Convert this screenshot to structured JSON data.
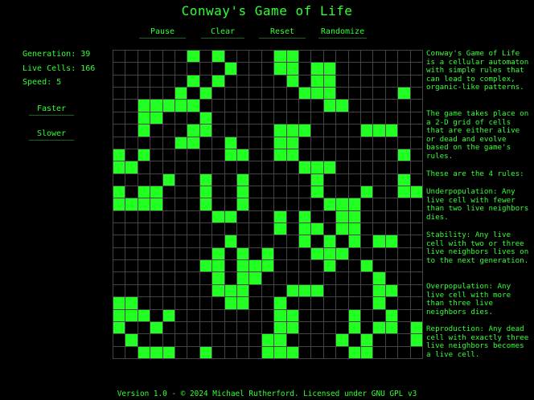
{
  "title": "Conway's Game of Life",
  "controls": {
    "pause": "Pause",
    "clear": "Clear",
    "reset": "Reset",
    "randomize": "Randomize"
  },
  "stats": {
    "generation": "Generation: 39",
    "live_cells": "Live Cells: 166",
    "speed": "Speed: 5"
  },
  "speed_controls": {
    "faster": "Faster",
    "slower": "Slower"
  },
  "info": {
    "intro": "Conway's Game of Life is a cellular automaton with simple rules that can lead to complex, organic-like patterns.",
    "grid_desc": "The game takes place on a 2-D grid of cells that are either alive or dead and evolve based on the game's rules.",
    "rules_header": "These are the 4 rules:",
    "underpopulation": "Underpopulation: Any live cell with fewer than two live neighbors dies.",
    "stability": "Stability: Any live cell with two or three live neighbors lives on to the next generation.",
    "overpopulation": "Overpopulation: Any live cell with more than three live neighbors dies.",
    "reproduction": "Reproduction: Any dead cell with exactly three live neighbors becomes a live cell."
  },
  "footer": "Version 1.0 - © 2024 Michael Rutherford. Licensed under GNU GPL v3",
  "colors": {
    "alive": "#22ff22",
    "text": "#33ff33",
    "grid_line": "#444444",
    "background": "#000000"
  },
  "board": {
    "rows": 25,
    "cols": 25,
    "alive": [
      [
        0,
        6
      ],
      [
        0,
        8
      ],
      [
        0,
        13
      ],
      [
        0,
        14
      ],
      [
        1,
        9
      ],
      [
        1,
        13
      ],
      [
        1,
        14
      ],
      [
        1,
        16
      ],
      [
        1,
        17
      ],
      [
        2,
        6
      ],
      [
        2,
        8
      ],
      [
        2,
        14
      ],
      [
        2,
        16
      ],
      [
        2,
        17
      ],
      [
        3,
        5
      ],
      [
        3,
        7
      ],
      [
        3,
        15
      ],
      [
        3,
        16
      ],
      [
        3,
        17
      ],
      [
        3,
        23
      ],
      [
        4,
        2
      ],
      [
        4,
        3
      ],
      [
        4,
        4
      ],
      [
        4,
        5
      ],
      [
        4,
        6
      ],
      [
        4,
        17
      ],
      [
        4,
        18
      ],
      [
        5,
        2
      ],
      [
        5,
        3
      ],
      [
        5,
        7
      ],
      [
        6,
        2
      ],
      [
        6,
        6
      ],
      [
        6,
        7
      ],
      [
        6,
        13
      ],
      [
        6,
        14
      ],
      [
        6,
        15
      ],
      [
        6,
        20
      ],
      [
        6,
        21
      ],
      [
        6,
        22
      ],
      [
        7,
        5
      ],
      [
        7,
        6
      ],
      [
        7,
        9
      ],
      [
        7,
        13
      ],
      [
        7,
        14
      ],
      [
        8,
        0
      ],
      [
        8,
        2
      ],
      [
        8,
        9
      ],
      [
        8,
        10
      ],
      [
        8,
        13
      ],
      [
        8,
        14
      ],
      [
        8,
        23
      ],
      [
        9,
        0
      ],
      [
        9,
        1
      ],
      [
        9,
        15
      ],
      [
        9,
        16
      ],
      [
        9,
        17
      ],
      [
        10,
        4
      ],
      [
        10,
        7
      ],
      [
        10,
        10
      ],
      [
        10,
        16
      ],
      [
        10,
        23
      ],
      [
        11,
        0
      ],
      [
        11,
        2
      ],
      [
        11,
        3
      ],
      [
        11,
        7
      ],
      [
        11,
        10
      ],
      [
        11,
        16
      ],
      [
        11,
        20
      ],
      [
        11,
        23
      ],
      [
        11,
        24
      ],
      [
        12,
        0
      ],
      [
        12,
        1
      ],
      [
        12,
        2
      ],
      [
        12,
        3
      ],
      [
        12,
        7
      ],
      [
        12,
        10
      ],
      [
        12,
        17
      ],
      [
        12,
        18
      ],
      [
        12,
        19
      ],
      [
        13,
        8
      ],
      [
        13,
        9
      ],
      [
        13,
        13
      ],
      [
        13,
        15
      ],
      [
        13,
        18
      ],
      [
        13,
        19
      ],
      [
        14,
        13
      ],
      [
        14,
        15
      ],
      [
        14,
        16
      ],
      [
        14,
        18
      ],
      [
        14,
        19
      ],
      [
        15,
        9
      ],
      [
        15,
        15
      ],
      [
        15,
        17
      ],
      [
        15,
        19
      ],
      [
        15,
        21
      ],
      [
        15,
        22
      ],
      [
        16,
        8
      ],
      [
        16,
        10
      ],
      [
        16,
        12
      ],
      [
        16,
        16
      ],
      [
        16,
        17
      ],
      [
        16,
        18
      ],
      [
        17,
        7
      ],
      [
        17,
        8
      ],
      [
        17,
        10
      ],
      [
        17,
        11
      ],
      [
        17,
        12
      ],
      [
        17,
        17
      ],
      [
        17,
        20
      ],
      [
        18,
        8
      ],
      [
        18,
        10
      ],
      [
        18,
        11
      ],
      [
        18,
        21
      ],
      [
        19,
        8
      ],
      [
        19,
        9
      ],
      [
        19,
        10
      ],
      [
        19,
        14
      ],
      [
        19,
        15
      ],
      [
        19,
        16
      ],
      [
        19,
        21
      ],
      [
        19,
        22
      ],
      [
        20,
        0
      ],
      [
        20,
        1
      ],
      [
        20,
        9
      ],
      [
        20,
        10
      ],
      [
        20,
        13
      ],
      [
        20,
        21
      ],
      [
        21,
        0
      ],
      [
        21,
        1
      ],
      [
        21,
        2
      ],
      [
        21,
        4
      ],
      [
        21,
        13
      ],
      [
        21,
        14
      ],
      [
        21,
        19
      ],
      [
        21,
        22
      ],
      [
        22,
        0
      ],
      [
        22,
        3
      ],
      [
        22,
        13
      ],
      [
        22,
        14
      ],
      [
        22,
        19
      ],
      [
        22,
        21
      ],
      [
        22,
        22
      ],
      [
        22,
        24
      ],
      [
        23,
        1
      ],
      [
        23,
        12
      ],
      [
        23,
        13
      ],
      [
        23,
        18
      ],
      [
        23,
        20
      ],
      [
        23,
        24
      ],
      [
        24,
        2
      ],
      [
        24,
        3
      ],
      [
        24,
        4
      ],
      [
        24,
        7
      ],
      [
        24,
        12
      ],
      [
        24,
        13
      ],
      [
        24,
        14
      ],
      [
        24,
        19
      ],
      [
        24,
        20
      ]
    ]
  }
}
